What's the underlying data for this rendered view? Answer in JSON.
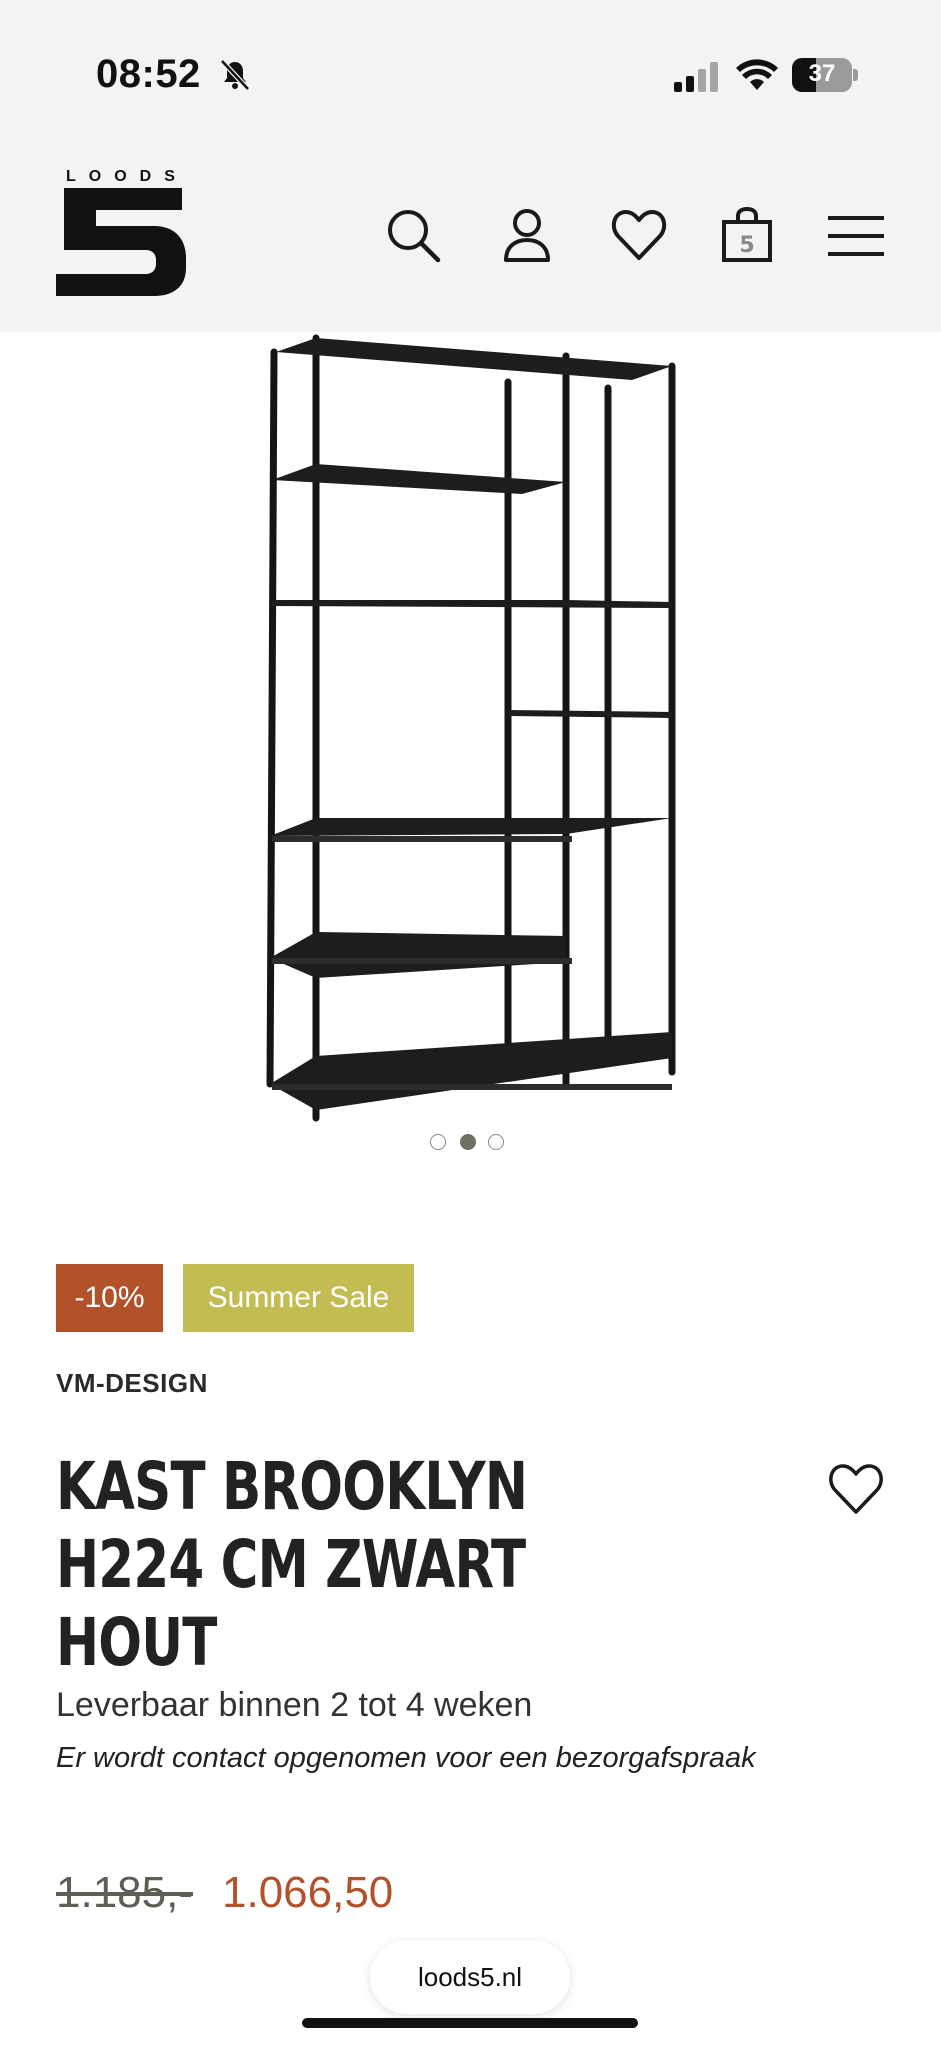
{
  "status_bar": {
    "time": "08:52",
    "battery_level": "37",
    "icons": [
      "bell-off-icon",
      "cellular-signal-icon",
      "wifi-icon",
      "battery-icon"
    ]
  },
  "header": {
    "logo_word": "LOODS",
    "logo_number": "5",
    "icons": [
      "search-icon",
      "account-icon",
      "wishlist-icon",
      "cart-icon",
      "menu-icon"
    ],
    "cart_badge": "5"
  },
  "gallery": {
    "image_alt": "Kast Brooklyn open shelving unit, black",
    "slide_count": 3,
    "active_slide": 2
  },
  "product": {
    "badges": {
      "discount": "-10%",
      "sale": "Summer Sale"
    },
    "brand": "VM-DESIGN",
    "title": "KAST BROOKLYN H224 CM ZWART HOUT",
    "delivery": "Leverbaar binnen 2 tot 4 weken",
    "delivery_note": "Er wordt contact opgenomen voor een bezorgafspraak",
    "price_old": "1.185,-",
    "price_new": "1.066,50"
  },
  "browser": {
    "url": "loods5.nl"
  },
  "colors": {
    "header_bg": "#f3f3f3",
    "discount_badge": "#b2522b",
    "sale_badge": "#c3bc52",
    "price_new": "#b2522b"
  }
}
